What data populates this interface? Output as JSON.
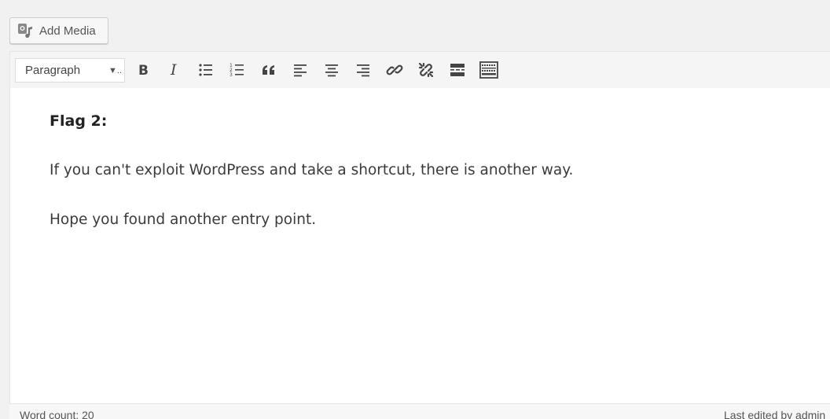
{
  "media": {
    "add_label": "Add Media"
  },
  "toolbar": {
    "format_value": "Paragraph",
    "buttons": [
      {
        "name": "bold-button",
        "icon": "bold-icon"
      },
      {
        "name": "italic-button",
        "icon": "italic-icon"
      },
      {
        "name": "bulleted-list-button",
        "icon": "bulleted-list-icon"
      },
      {
        "name": "numbered-list-button",
        "icon": "numbered-list-icon"
      },
      {
        "name": "blockquote-button",
        "icon": "blockquote-icon"
      },
      {
        "name": "align-left-button",
        "icon": "align-left-icon"
      },
      {
        "name": "align-center-button",
        "icon": "align-center-icon"
      },
      {
        "name": "align-right-button",
        "icon": "align-right-icon"
      },
      {
        "name": "insert-link-button",
        "icon": "link-icon"
      },
      {
        "name": "remove-link-button",
        "icon": "unlink-icon"
      },
      {
        "name": "read-more-button",
        "icon": "read-more-icon"
      },
      {
        "name": "toolbar-toggle-button",
        "icon": "keyboard-icon"
      }
    ]
  },
  "content": {
    "heading": "Flag 2:",
    "paragraphs": [
      "If you can't exploit WordPress and take a shortcut, there is another way.",
      "Hope you found another entry point."
    ]
  },
  "status": {
    "word_count": "Word count: 20",
    "last_edited": "Last edited by admin"
  }
}
